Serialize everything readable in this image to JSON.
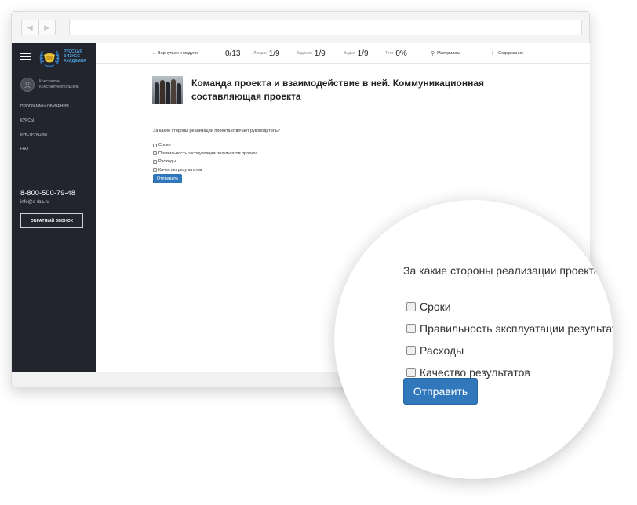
{
  "browser": {
    "back_glyph": "◀",
    "forward_glyph": "▶"
  },
  "sidebar": {
    "logo_lines": [
      "Русская",
      "Бизнес",
      "Академия"
    ],
    "user": {
      "first_name": "Константин",
      "last_name": "Константинопольский"
    },
    "menu": [
      {
        "label": "Программы обучения"
      },
      {
        "label": "Курсы"
      },
      {
        "label": "Инструкции"
      },
      {
        "label": "FAQ"
      }
    ],
    "phone": "8-800-500-79-48",
    "email": "info@e-rba.ru",
    "callback_label": "Обратный звонок"
  },
  "topbar": {
    "back_label": "← Вернуться к модулю",
    "progress": "0/13",
    "lectures_label": "Лекции",
    "lectures_value": "1/9",
    "tasks_label": "Задания",
    "tasks_value": "1/9",
    "video_label": "Видео",
    "video_value": "1/9",
    "test_label": "Тест",
    "test_value": "0%",
    "materials_label": "Материалы",
    "contents_label": "Содержание"
  },
  "lesson": {
    "title": "Команда проекта и взаимодействие в ней. Коммуникационная составляющая проекта",
    "question": "За какие стороны реализации проекта отвечает руководитель?",
    "options": [
      {
        "label": "Сроки",
        "checked": false
      },
      {
        "label": "Правильность эксплуатации результатов проекта",
        "checked": false
      },
      {
        "label": "Расходы",
        "checked": false
      },
      {
        "label": "Качество результатов",
        "checked": false
      }
    ],
    "submit_label": "Отправить"
  },
  "magnifier": {
    "question": "За какие стороны реализации проекта",
    "options": [
      {
        "label": "Сроки"
      },
      {
        "label": "Правильность эксплуатации результатов"
      },
      {
        "label": "Расходы"
      },
      {
        "label": "Качество результатов"
      }
    ],
    "submit_label": "Отправить"
  },
  "colors": {
    "sidebar_bg": "#23252e",
    "accent_blue": "#2f76ba",
    "logo_blue": "#4fa3e0"
  }
}
